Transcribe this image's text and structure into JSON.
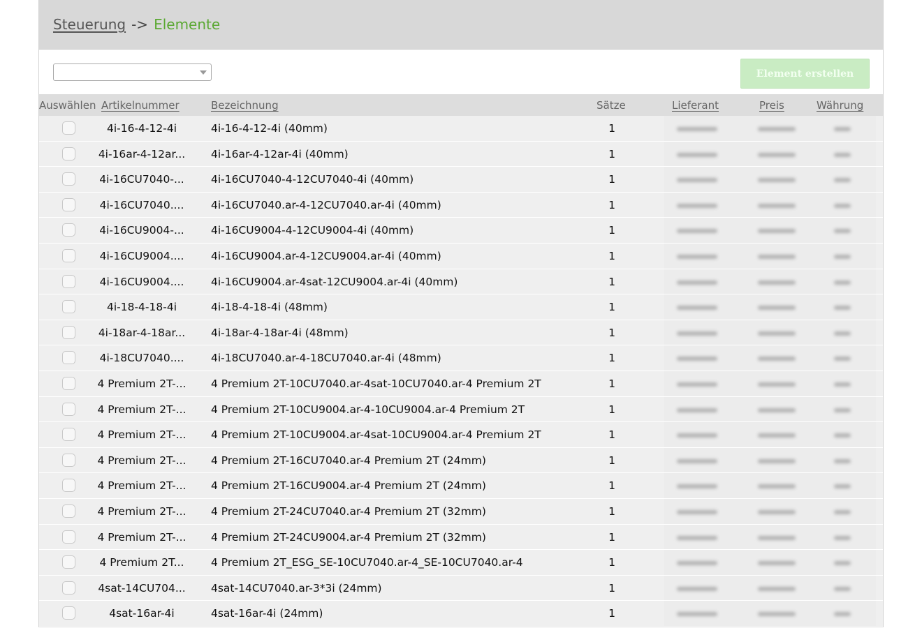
{
  "breadcrumb": {
    "root": "Steuerung",
    "separator": "->",
    "current": "Elemente"
  },
  "filter": {
    "selected": ""
  },
  "toolbar": {
    "create_label": "Element erstellen"
  },
  "table": {
    "headers": {
      "select": "Auswählen",
      "article": "Artikelnummer",
      "name": "Bezeichnung",
      "sets": "Sätze",
      "supplier": "Lieferant",
      "price": "Preis",
      "currency": "Währung"
    },
    "rows": [
      {
        "article": "4i-16-4-12-4i",
        "name": "4i-16-4-12-4i (40mm)",
        "sets": "1"
      },
      {
        "article": "4i-16ar-4-12ar...",
        "name": "4i-16ar-4-12ar-4i (40mm)",
        "sets": "1"
      },
      {
        "article": "4i-16CU7040-...",
        "name": "4i-16CU7040-4-12CU7040-4i (40mm)",
        "sets": "1"
      },
      {
        "article": "4i-16CU7040....",
        "name": "4i-16CU7040.ar-4-12CU7040.ar-4i (40mm)",
        "sets": "1"
      },
      {
        "article": "4i-16CU9004-...",
        "name": "4i-16CU9004-4-12CU9004-4i (40mm)",
        "sets": "1"
      },
      {
        "article": "4i-16CU9004....",
        "name": "4i-16CU9004.ar-4-12CU9004.ar-4i (40mm)",
        "sets": "1"
      },
      {
        "article": "4i-16CU9004....",
        "name": "4i-16CU9004.ar-4sat-12CU9004.ar-4i (40mm)",
        "sets": "1"
      },
      {
        "article": "4i-18-4-18-4i",
        "name": "4i-18-4-18-4i (48mm)",
        "sets": "1"
      },
      {
        "article": "4i-18ar-4-18ar...",
        "name": "4i-18ar-4-18ar-4i (48mm)",
        "sets": "1"
      },
      {
        "article": "4i-18CU7040....",
        "name": "4i-18CU7040.ar-4-18CU7040.ar-4i (48mm)",
        "sets": "1"
      },
      {
        "article": "4 Premium 2T-...",
        "name": "4 Premium 2T-10CU7040.ar-4sat-10CU7040.ar-4 Premium 2T",
        "sets": "1"
      },
      {
        "article": "4 Premium 2T-...",
        "name": "4 Premium 2T-10CU9004.ar-4-10CU9004.ar-4 Premium 2T",
        "sets": "1"
      },
      {
        "article": "4 Premium 2T-...",
        "name": "4 Premium 2T-10CU9004.ar-4sat-10CU9004.ar-4 Premium 2T",
        "sets": "1"
      },
      {
        "article": "4 Premium 2T-...",
        "name": "4 Premium 2T-16CU7040.ar-4 Premium 2T (24mm)",
        "sets": "1"
      },
      {
        "article": "4 Premium 2T-...",
        "name": "4 Premium 2T-16CU9004.ar-4 Premium 2T (24mm)",
        "sets": "1"
      },
      {
        "article": "4 Premium 2T-...",
        "name": "4 Premium 2T-24CU7040.ar-4 Premium 2T (32mm)",
        "sets": "1"
      },
      {
        "article": "4 Premium 2T-...",
        "name": "4 Premium 2T-24CU9004.ar-4 Premium 2T (32mm)",
        "sets": "1"
      },
      {
        "article": "4 Premium 2T...",
        "name": "4 Premium 2T_ESG_SE-10CU7040.ar-4_SE-10CU7040.ar-4",
        "sets": "1"
      },
      {
        "article": "4sat-14CU704...",
        "name": "4sat-14CU7040.ar-3*3i (24mm)",
        "sets": "1"
      },
      {
        "article": "4sat-16ar-4i",
        "name": "4sat-16ar-4i (24mm)",
        "sets": "1"
      }
    ]
  },
  "colors": {
    "header_bg": "#d8d8d8",
    "breadcrumb_current": "#5aa832",
    "create_button_bg": "#c9ecc3",
    "row_bg": "#efefef"
  },
  "icons": {
    "select_arrow": "chevron-down-icon",
    "row_checkbox": "checkbox-icon"
  }
}
